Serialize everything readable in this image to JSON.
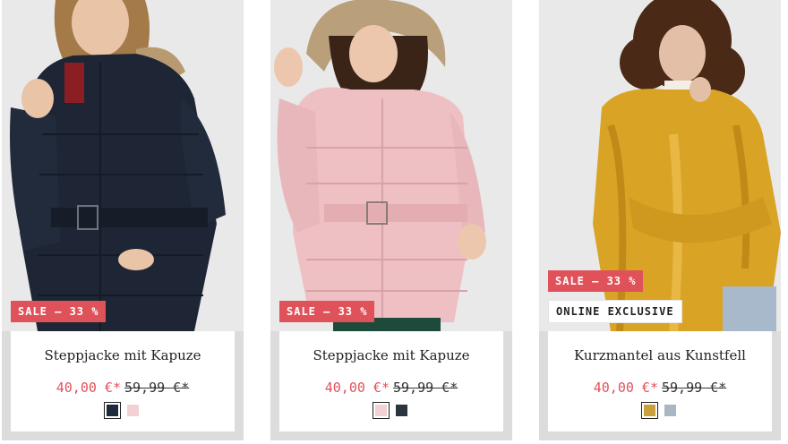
{
  "products": [
    {
      "badges": {
        "sale": "SALE – 33 %"
      },
      "name": "Steppjacke mit Kapuze",
      "price_new": "40,00 €*",
      "price_old": "59,99 €*",
      "swatches": [
        {
          "color": "#1f2a3c",
          "selected": true
        },
        {
          "color": "#f1d1d3",
          "selected": false
        }
      ]
    },
    {
      "badges": {
        "sale": "SALE – 33 %"
      },
      "name": "Steppjacke mit Kapuze",
      "price_new": "40,00 €*",
      "price_old": "59,99 €*",
      "swatches": [
        {
          "color": "#f1d1d3",
          "selected": true
        },
        {
          "color": "#2c3440",
          "selected": false
        }
      ]
    },
    {
      "badges": {
        "sale": "SALE – 33 %",
        "exclusive": "ONLINE EXCLUSIVE"
      },
      "name": "Kurzmantel aus Kunstfell",
      "price_new": "40,00 €*",
      "price_old": "59,99 €*",
      "swatches": [
        {
          "color": "#c9a03a",
          "selected": true
        },
        {
          "color": "#a9b6c4",
          "selected": false
        }
      ]
    }
  ]
}
